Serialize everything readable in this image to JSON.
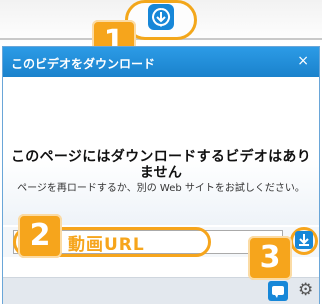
{
  "toolbar": {
    "icon": "download-extension-icon"
  },
  "badges": {
    "b1": "1",
    "b2": "2",
    "b3": "3"
  },
  "dialog": {
    "title": "このビデオをダウンロード",
    "close": "×",
    "message_main": "このページにはダウンロードするビデオはありません",
    "message_sub": "ページを再ロードするか、別の Web サイトをお試しください。",
    "url_label": "動画URL",
    "url_value": ""
  },
  "footer": {
    "icons": [
      "chat-icon",
      "gear-icon"
    ]
  },
  "colors": {
    "accent": "#1787d8",
    "highlight": "#f6a51c",
    "titlebar": "#1a82cc"
  }
}
